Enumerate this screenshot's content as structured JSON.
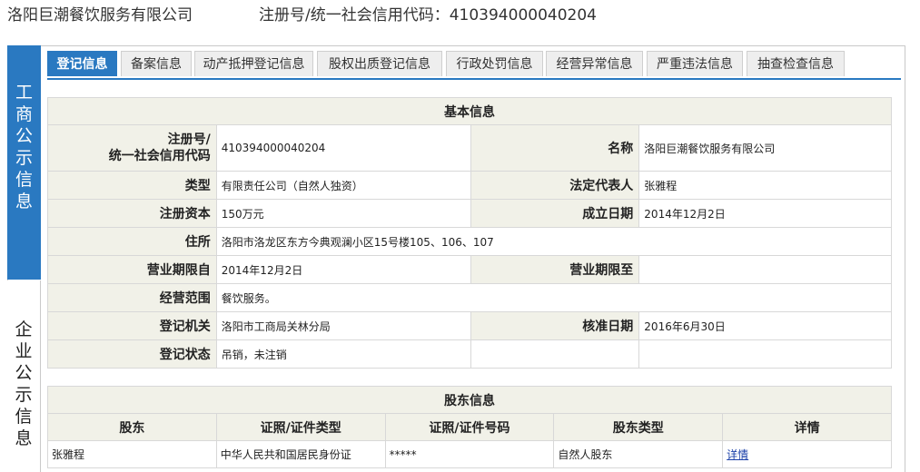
{
  "header": {
    "company_name": "洛阳巨潮餐饮服务有限公司",
    "reg_line": "注册号/统一社会信用代码：410394000040204"
  },
  "sidebar": {
    "gs": "工商公示信息",
    "qy": "企业公示信息"
  },
  "tabs": [
    {
      "label": "登记信息",
      "active": true
    },
    {
      "label": "备案信息"
    },
    {
      "label": "动产抵押登记信息"
    },
    {
      "label": "股权出质登记信息"
    },
    {
      "label": "行政处罚信息"
    },
    {
      "label": "经营异常信息"
    },
    {
      "label": "严重违法信息"
    },
    {
      "label": "抽查检查信息"
    }
  ],
  "basic": {
    "title": "基本信息",
    "reg_no_label_1": "注册号/",
    "reg_no_label_2": "统一社会信用代码",
    "reg_no": "410394000040204",
    "name_label": "名称",
    "name": "洛阳巨潮餐饮服务有限公司",
    "type_label": "类型",
    "type": "有限责任公司（自然人独资）",
    "legal_label": "法定代表人",
    "legal": "张雅程",
    "capital_label": "注册资本",
    "capital": "150万元",
    "founded_label": "成立日期",
    "founded": "2014年12月2日",
    "address_label": "住所",
    "address": "洛阳市洛龙区东方今典观澜小区15号楼105、106、107",
    "term_from_label": "营业期限自",
    "term_from": "2014年12月2日",
    "term_to_label": "营业期限至",
    "term_to": "",
    "scope_label": "经营范围",
    "scope": "餐饮服务。",
    "authority_label": "登记机关",
    "authority": "洛阳市工商局关林分局",
    "approval_label": "核准日期",
    "approval": "2016年6月30日",
    "status_label": "登记状态",
    "status": "吊销，未注销"
  },
  "shareholders": {
    "title": "股东信息",
    "headers": [
      "股东",
      "证照/证件类型",
      "证照/证件号码",
      "股东类型",
      "详情"
    ],
    "rows": [
      {
        "name": "张雅程",
        "id_type": "中华人民共和国居民身份证",
        "id_no": "*****",
        "holder_type": "自然人股东",
        "detail": "详情"
      }
    ]
  }
}
